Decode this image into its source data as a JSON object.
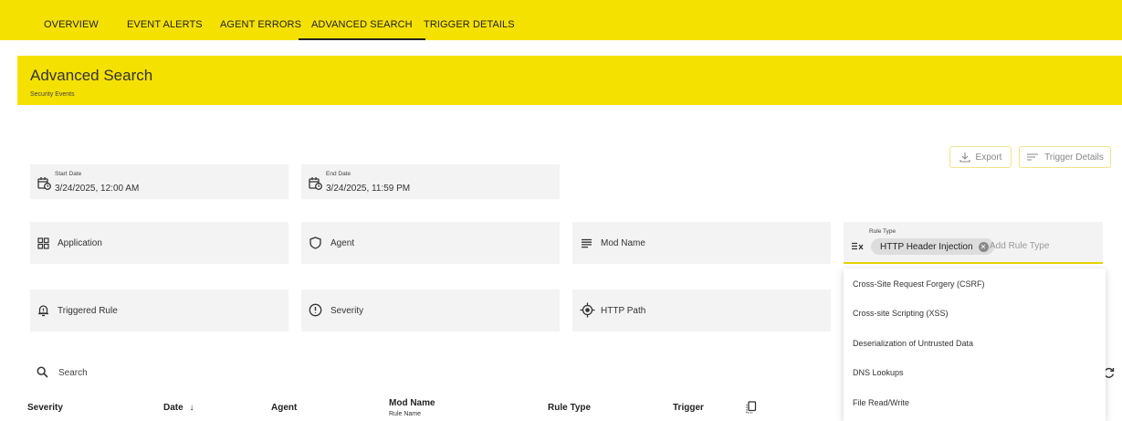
{
  "nav": {
    "tabs": [
      {
        "label": "OVERVIEW"
      },
      {
        "label": "EVENT ALERTS"
      },
      {
        "label": "AGENT ERRORS"
      },
      {
        "label": "ADVANCED SEARCH"
      },
      {
        "label": "TRIGGER DETAILS"
      }
    ],
    "active_index": 3
  },
  "header": {
    "title": "Advanced Search",
    "subtitle": "Security Events"
  },
  "toolbar": {
    "export_label": "Export",
    "trigger_details_label": "Trigger Details"
  },
  "filters": {
    "start_date": {
      "label": "Start Date",
      "value": "3/24/2025, 12:00 AM"
    },
    "end_date": {
      "label": "End Date",
      "value": "3/24/2025, 11:59 PM"
    },
    "application": "Application",
    "agent": "Agent",
    "mod_name": "Mod Name",
    "rule_type": {
      "label": "Rule Type",
      "chip": "HTTP Header Injection",
      "placeholder": "Add Rule Type"
    },
    "triggered_rule": "Triggered Rule",
    "severity": "Severity",
    "http_path": "HTTP Path"
  },
  "rule_type_options": [
    "Cross-Site Request Forgery (CSRF)",
    "Cross-site Scripting (XSS)",
    "Deserialization of Untrusted Data",
    "DNS Lookups",
    "File Read/Write"
  ],
  "search": {
    "placeholder": "Search"
  },
  "table": {
    "columns": {
      "severity": "Severity",
      "date": "Date",
      "date_sort": "↓",
      "agent": "Agent",
      "mod_name": "Mod Name",
      "rule_name": "Rule Name",
      "rule_type": "Rule Type",
      "trigger": "Trigger"
    }
  },
  "colors": {
    "brand_yellow": "#f5e100",
    "field_bg": "#f3f3f3"
  }
}
